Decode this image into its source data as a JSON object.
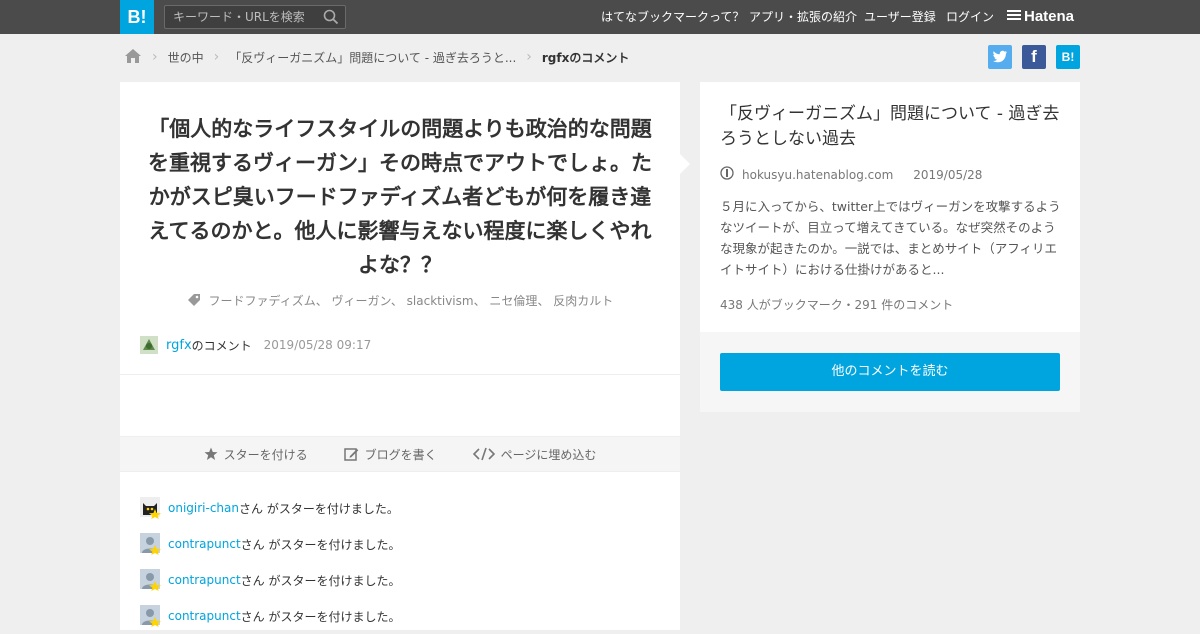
{
  "topbar": {
    "logo": "B!",
    "search_placeholder": "キーワード・URLを検索",
    "nav": [
      "はてなブックマークって？",
      "アプリ・拡張の紹介",
      "ユーザー登録",
      "ログイン"
    ],
    "brand": "Hatena"
  },
  "breadcrumb": {
    "items": [
      "世の中",
      "「反ヴィーガニズム」問題について - 過ぎ去ろうと..."
    ],
    "current": "rgfxのコメント"
  },
  "share": [
    "twitter",
    "facebook",
    "B!"
  ],
  "comment": {
    "text": "「個人的なライフスタイルの問題よりも政治的な問題を重視するヴィーガン」その時点でアウトでしょ。たかがスピ臭いフードファディズム者どもが何を履き違えてるのかと。他人に影響与えない程度に楽しくやれよな？？",
    "tags": [
      "フードファディズム",
      "ヴィーガン",
      "slacktivism",
      "ニセ倫理",
      "反肉カルト"
    ],
    "user": "rgfx",
    "user_suffix": "のコメント",
    "date": "2019/05/28 09:17"
  },
  "actions": [
    "スターを付ける",
    "ブログを書く",
    "ページに埋め込む"
  ],
  "stars": [
    {
      "user": "onigiri-chan",
      "text": "さん がスターを付けました。"
    },
    {
      "user": "contrapunct",
      "text": "さん がスターを付けました。"
    },
    {
      "user": "contrapunct",
      "text": "さん がスターを付けました。"
    },
    {
      "user": "contrapunct",
      "text": "さん がスターを付けました。"
    }
  ],
  "entry": {
    "title": "「反ヴィーガニズム」問題について - 過ぎ去ろうとしない過去",
    "domain": "hokusyu.hatenablog.com",
    "date": "2019/05/28",
    "description": "５月に入ってから、twitter上ではヴィーガンを攻撃するようなツイートが、目立って増えてきている。なぜ突然そのような現象が起きたのか。一説では、まとめサイト（アフィリエイトサイト）における仕掛けがあると...",
    "stats": "438 人がブックマーク・291 件のコメント",
    "more_button": "他のコメントを読む"
  },
  "colors": {
    "accent": "#00a4de",
    "topbar": "#4b4b4b",
    "twitter": "#55acee",
    "facebook": "#3b5998"
  }
}
